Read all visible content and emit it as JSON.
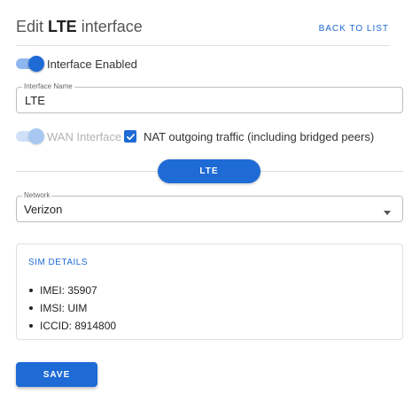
{
  "header": {
    "title_prefix": "Edit ",
    "title_bold": "LTE",
    "title_suffix": " interface",
    "back_link": "BACK TO LIST"
  },
  "interface_enabled": {
    "label": "Interface Enabled",
    "on": true
  },
  "interface_name": {
    "legend": "Interface Name",
    "value": "LTE"
  },
  "wan_interface": {
    "label": "WAN Interface",
    "on": true,
    "disabled": true
  },
  "nat": {
    "label": "NAT outgoing traffic (including bridged peers)",
    "checked": true
  },
  "section_pill": {
    "label": "LTE"
  },
  "network": {
    "legend": "Network",
    "value": "Verizon"
  },
  "sim_details": {
    "title": "SIM DETAILS",
    "items": [
      "IMEI: 35907",
      "IMSI: UIM",
      "ICCID: 8914800"
    ]
  },
  "save_button": {
    "label": "SAVE"
  },
  "colors": {
    "accent": "#1e6bd6",
    "accent_light": "#8fb6ee",
    "border": "#bdbdbd"
  }
}
